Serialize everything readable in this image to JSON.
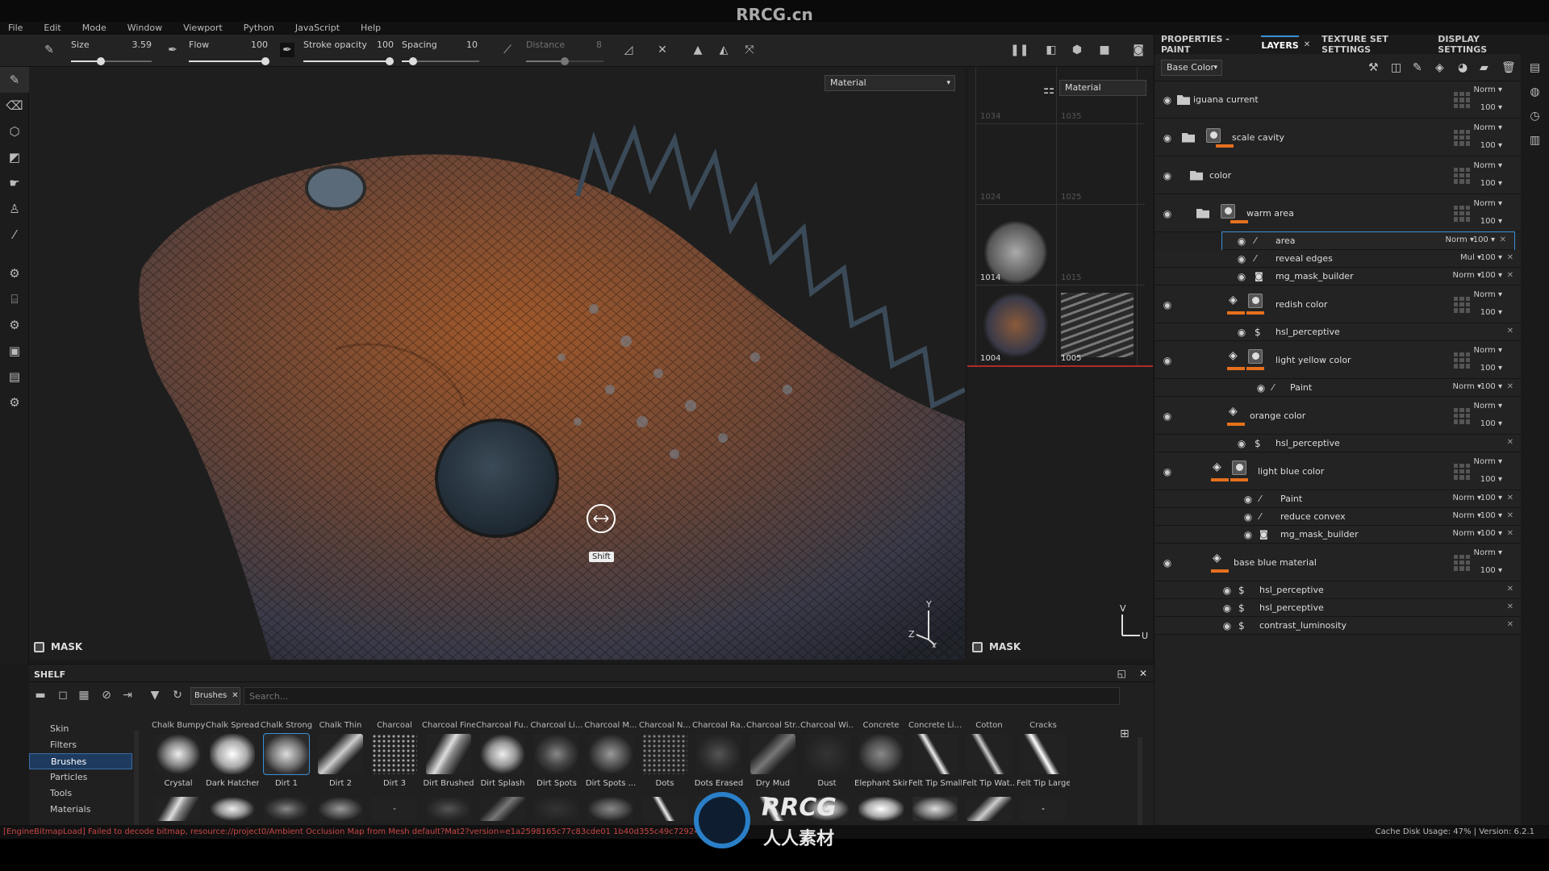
{
  "watermark_title": "RRCG.cn",
  "menu": [
    "File",
    "Edit",
    "Mode",
    "Window",
    "Viewport",
    "Python",
    "JavaScript",
    "Help"
  ],
  "toolbar": {
    "size_label": "Size",
    "size_value": "3.59",
    "size_fraction": 0.36,
    "flow_label": "Flow",
    "flow_value": "100",
    "flow_fraction": 1.0,
    "opacity_label": "Stroke opacity",
    "opacity_value": "100",
    "opacity_fraction": 1.0,
    "spacing_label": "Spacing",
    "spacing_value": "10",
    "spacing_fraction": 0.1,
    "distance_label": "Distance",
    "distance_value": "8",
    "distance_fraction": 0.5
  },
  "viewport": {
    "channel_select": "Material",
    "channel_select_2d": "Material",
    "mask_label": "MASK",
    "mask_label_2d": "MASK",
    "tooltip": "Shift",
    "axis_y": "Y",
    "axis_z": "Z",
    "axis_x": "X",
    "uv_v": "V",
    "uv_u": "U",
    "uv_tiles": [
      "1034",
      "1035",
      "1024",
      "1025",
      "1014",
      "1015",
      "1004",
      "1005"
    ]
  },
  "rightpanel": {
    "tabs": [
      "PROPERTIES - PAINT",
      "LAYERS",
      "TEXTURE SET SETTINGS",
      "DISPLAY SETTINGS"
    ],
    "channel": "Base Color",
    "layers": [
      {
        "name": "iguana current",
        "blend": "Norm",
        "opacity": "100"
      },
      {
        "name": "scale cavity",
        "blend": "Norm",
        "opacity": "100"
      },
      {
        "name": "color",
        "blend": "Norm",
        "opacity": "100"
      },
      {
        "name": "warm area",
        "blend": "Norm",
        "opacity": "100"
      },
      {
        "name": "area",
        "blend": "Norm",
        "opacity": "100"
      },
      {
        "name": "reveal edges",
        "blend": "Mul",
        "opacity": "100"
      },
      {
        "name": "mg_mask_builder",
        "blend": "Norm",
        "opacity": "100"
      },
      {
        "name": "redish color",
        "blend": "Norm",
        "opacity": "100"
      },
      {
        "name": "hsl_perceptive"
      },
      {
        "name": "light yellow color",
        "blend": "Norm",
        "opacity": "100"
      },
      {
        "name": "Paint",
        "blend": "Norm",
        "opacity": "100"
      },
      {
        "name": "orange color",
        "blend": "Norm",
        "opacity": "100"
      },
      {
        "name": "hsl_perceptive"
      },
      {
        "name": "light blue color",
        "blend": "Norm",
        "opacity": "100"
      },
      {
        "name": "Paint",
        "blend": "Norm",
        "opacity": "100"
      },
      {
        "name": "reduce convex",
        "blend": "Norm",
        "opacity": "100"
      },
      {
        "name": "mg_mask_builder",
        "blend": "Norm",
        "opacity": "100"
      },
      {
        "name": "base blue material",
        "blend": "Norm",
        "opacity": "100"
      },
      {
        "name": "hsl_perceptive"
      },
      {
        "name": "hsl_perceptive"
      },
      {
        "name": "contrast_luminosity"
      }
    ]
  },
  "shelf": {
    "title": "SHELF",
    "filter_tag": "Brushes",
    "search_placeholder": "Search...",
    "categories": [
      "Skin",
      "Filters",
      "Brushes",
      "Particles",
      "Tools",
      "Materials"
    ],
    "brush_headers": [
      "Chalk Bumpy",
      "Chalk Spread",
      "Chalk Strong",
      "Chalk Thin",
      "Charcoal",
      "Charcoal Fine",
      "Charcoal Fu...",
      "Charcoal Li...",
      "Charcoal M...",
      "Charcoal N...",
      "Charcoal Ra...",
      "Charcoal Str...",
      "Charcoal Wi...",
      "Concrete",
      "Concrete Li...",
      "Cotton",
      "Cracks"
    ],
    "brushes": [
      "Crystal",
      "Dark Hatcher",
      "Dirt 1",
      "Dirt 2",
      "Dirt 3",
      "Dirt Brushed",
      "Dirt Splash",
      "Dirt Spots",
      "Dirt Spots ...",
      "Dots",
      "Dots Erased",
      "Dry Mud",
      "Dust",
      "Elephant Skin",
      "Felt Tip Small",
      "Felt Tip Wat...",
      "Felt Tip Large"
    ]
  },
  "status": {
    "error": "[EngineBitmapLoad] Failed to decode bitmap, resource://project0/Ambient Occlusion Map from Mesh default?Mat2?version=e1a2598165c77c83cde01 1b40d355c49c7292464.m",
    "right": "Cache Disk Usage:  47% | Version: 6.2.1"
  },
  "watermark": {
    "line1": "RRCG",
    "line2": "人人素材"
  },
  "colors": {
    "accent": "#3a8fd8",
    "orange": "#e5701d",
    "error": "#c94545"
  }
}
